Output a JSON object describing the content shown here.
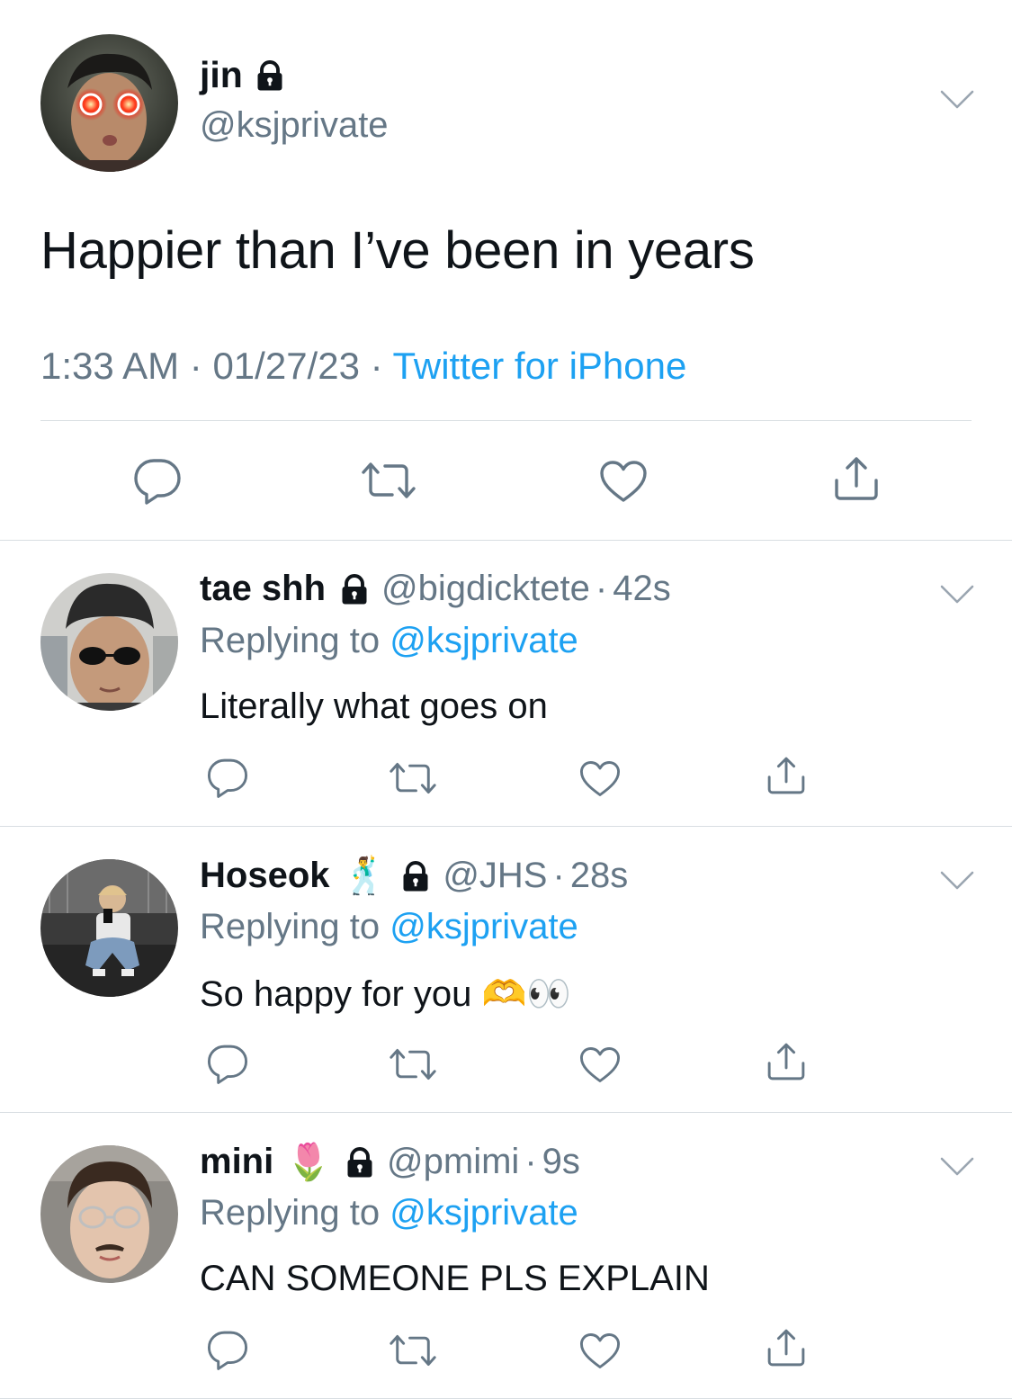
{
  "main_tweet": {
    "display_name": "jin",
    "handle": "@ksjprivate",
    "text": "Happier than I’ve been in years",
    "time": "1:33 AM",
    "date": "01/27/23",
    "source": "Twitter for iPhone",
    "meta_sep": "·",
    "icons": [
      "lock-icon",
      "chevron-down-icon",
      "reply-icon",
      "retweet-icon",
      "like-icon",
      "share-icon"
    ]
  },
  "replies": [
    {
      "display_name": "tae shh",
      "name_emoji": "",
      "handle": "@bigdicktete",
      "sep": "·",
      "time": "42s",
      "replying_prefix": "Replying to",
      "replying_to": "@ksjprivate",
      "text": "Literally what goes on"
    },
    {
      "display_name": "Hoseok",
      "name_emoji": "🕺",
      "handle": "@JHS",
      "sep": "·",
      "time": "28s",
      "replying_prefix": "Replying to",
      "replying_to": "@ksjprivate",
      "text": "So happy for you 🫶👀"
    },
    {
      "display_name": "mini",
      "name_emoji": "🌷",
      "handle": "@pmimi",
      "sep": "·",
      "time": "9s",
      "replying_prefix": "Replying to",
      "replying_to": "@ksjprivate",
      "text": "CAN SOMEONE PLS EXPLAIN"
    }
  ],
  "colors": {
    "text": "#0f1419",
    "secondary": "#657786",
    "accent": "#1da1f2",
    "divider": "#d9dee2"
  }
}
